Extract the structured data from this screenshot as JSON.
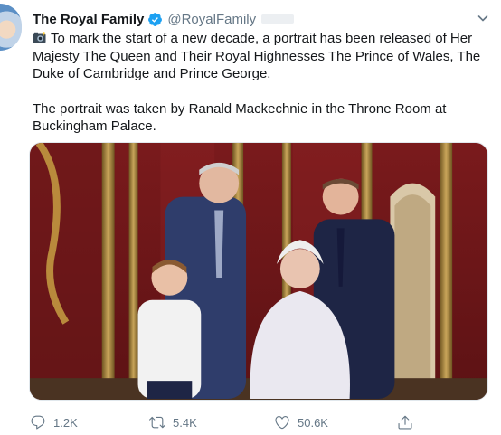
{
  "tweet": {
    "author_name": "The Royal Family",
    "author_handle": "@RoyalFamily",
    "text_p1": "To mark the start of a new decade, a portrait has been released of Her Majesty The Queen and Their Royal Highnesses The Prince of Wales, The Duke of Cambridge and Prince George.",
    "text_p2": "The portrait was taken by Ranald Mackechnie in the Throne Room at Buckingham Palace.",
    "emoji": "camera-with-flash-icon",
    "photo_icon": "royal-portrait-photo"
  },
  "actions": {
    "reply_count": "1.2K",
    "retweet_count": "5.4K",
    "like_count": "50.6K"
  },
  "colors": {
    "verified": "#1da1f2",
    "muted": "#657786",
    "text": "#14171a",
    "background": "#ffffff"
  }
}
